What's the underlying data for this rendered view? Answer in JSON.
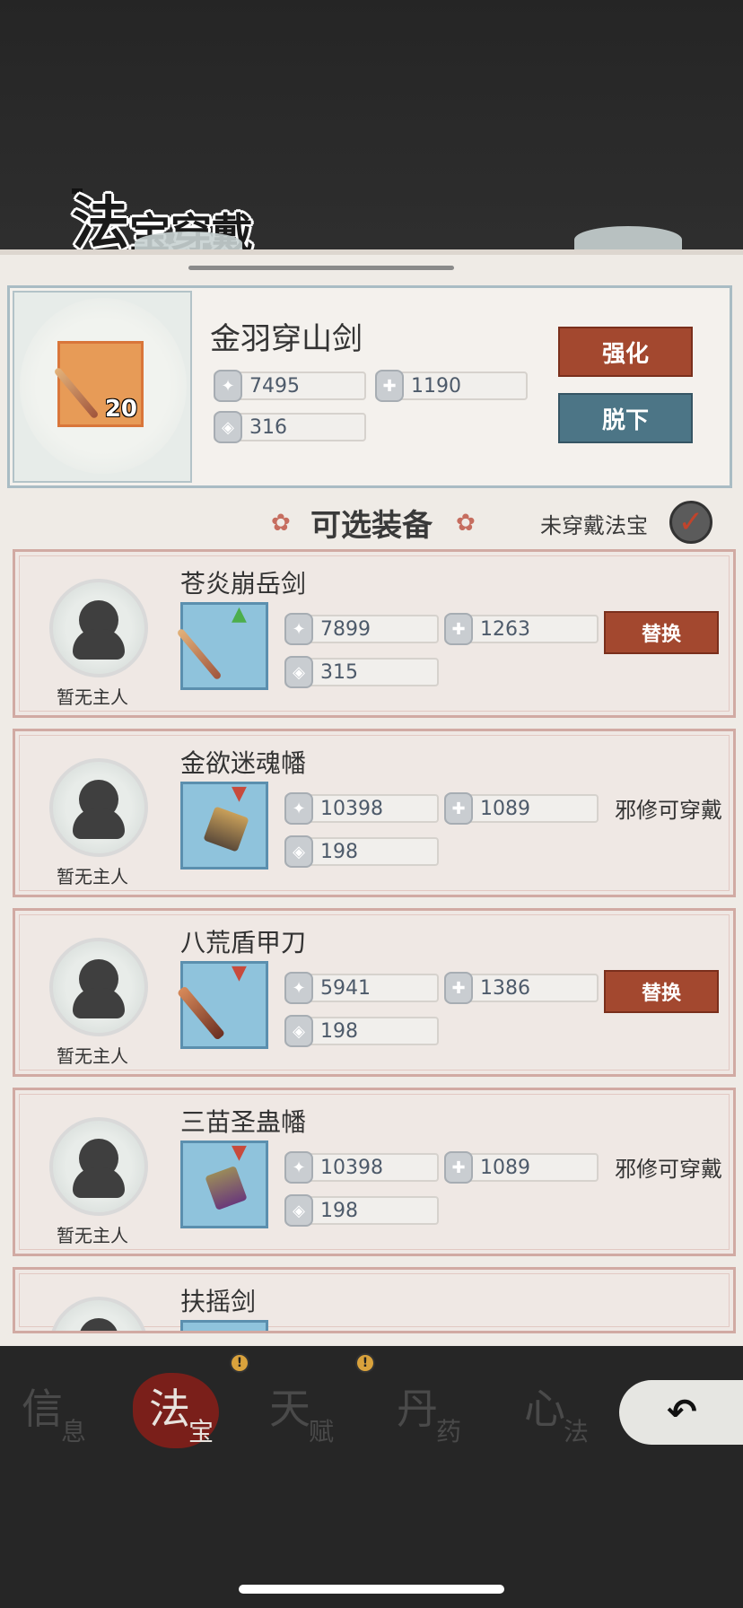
{
  "header": {
    "title_part1": "法",
    "title_part2": "宝",
    "title_part3": "穿",
    "title_part4": "戴"
  },
  "current": {
    "name": "金羽穿山剑",
    "level": "20",
    "attack": "7495",
    "hp": "1190",
    "defense": "316",
    "enhance_label": "强化",
    "remove_label": "脱下"
  },
  "section": {
    "title": "可选装备",
    "unequipped_label": "未穿戴法宝"
  },
  "items": [
    {
      "name": "苍炎崩岳剑",
      "owner": "暂无主人",
      "attack": "7899",
      "hp": "1263",
      "defense": "315",
      "action": "替换",
      "arrow": "▲"
    },
    {
      "name": "金欲迷魂幡",
      "owner": "暂无主人",
      "attack": "10398",
      "hp": "1089",
      "defense": "198",
      "action": "邪修可穿戴",
      "arrow": "▼"
    },
    {
      "name": "八荒盾甲刀",
      "owner": "暂无主人",
      "attack": "5941",
      "hp": "1386",
      "defense": "198",
      "action": "替换",
      "arrow": "▼"
    },
    {
      "name": "三苗圣蛊幡",
      "owner": "暂无主人",
      "attack": "10398",
      "hp": "1089",
      "defense": "198",
      "action": "邪修可穿戴",
      "arrow": "▼"
    },
    {
      "name": "扶摇剑"
    }
  ],
  "tabs": [
    {
      "big": "信",
      "small": "息"
    },
    {
      "big": "法",
      "small": "宝"
    },
    {
      "big": "天",
      "small": "赋"
    },
    {
      "big": "丹",
      "small": "药"
    },
    {
      "big": "心",
      "small": "法"
    }
  ],
  "alert_mark": "!",
  "back_label": "↶",
  "colors": {
    "accent_red": "#a3482f",
    "accent_teal": "#4c7586",
    "panel": "#efebe6"
  }
}
